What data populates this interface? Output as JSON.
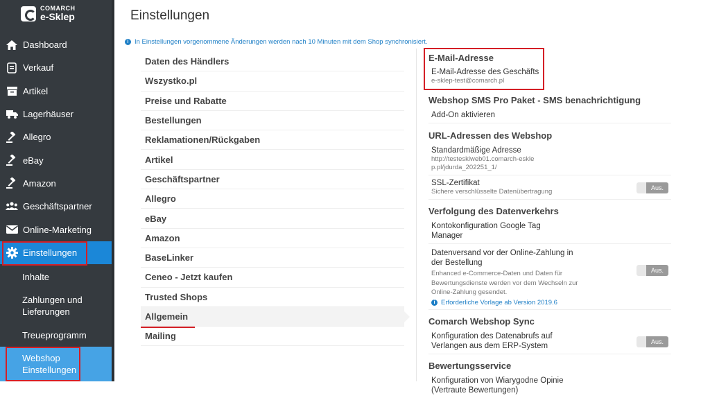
{
  "logo": {
    "line1": "COMARCH",
    "line2": "e-Sklep"
  },
  "sidebar": {
    "items": [
      {
        "label": "Dashboard"
      },
      {
        "label": "Verkauf"
      },
      {
        "label": "Artikel"
      },
      {
        "label": "Lagerhäuser"
      },
      {
        "label": "Allegro"
      },
      {
        "label": "eBay"
      },
      {
        "label": "Amazon"
      },
      {
        "label": "Geschäftspartner"
      },
      {
        "label": "Online-Marketing"
      },
      {
        "label": "Einstellungen"
      }
    ],
    "subitems": [
      {
        "label": "Inhalte"
      },
      {
        "label": "Zahlungen und Lieferungen"
      },
      {
        "label": "Treueprogramm"
      },
      {
        "label": "Webshop Einstellungen"
      }
    ]
  },
  "page": {
    "title": "Einstellungen",
    "info": "In Einstellungen vorgenommene Änderungen werden nach 10 Minuten mit dem Shop synchronisiert."
  },
  "menu": {
    "items": [
      {
        "label": "Daten des Händlers"
      },
      {
        "label": "Wszystko.pl"
      },
      {
        "label": "Preise und Rabatte"
      },
      {
        "label": "Bestellungen"
      },
      {
        "label": "Reklamationen/Rückgaben"
      },
      {
        "label": "Artikel"
      },
      {
        "label": "Geschäftspartner"
      },
      {
        "label": "Allegro"
      },
      {
        "label": "eBay"
      },
      {
        "label": "Amazon"
      },
      {
        "label": "BaseLinker"
      },
      {
        "label": "Ceneo - Jetzt kaufen"
      },
      {
        "label": "Trusted Shops"
      },
      {
        "label": "Allgemein"
      },
      {
        "label": "Mailing"
      }
    ]
  },
  "settings": {
    "email": {
      "title": "E-Mail-Adresse",
      "label": "E-Mail-Adresse des Geschäfts",
      "value": "e-sklep-test@comarch.pl"
    },
    "sms": {
      "title": "Webshop SMS Pro Paket - SMS benachrichtigung",
      "label": "Add-On aktivieren"
    },
    "urls": {
      "title": "URL-Adressen des Webshop",
      "std_label": "Standardmäßige Adresse",
      "std_value": "http://testesklweb01.comarch-esklep.pl/jdurda_202251_1/",
      "ssl_label": "SSL-Zertifikat",
      "ssl_desc": "Sichere verschlüsselte Datenübertragung",
      "ssl_toggle": "Aus."
    },
    "tracking": {
      "title": "Verfolgung des Datenverkehrs",
      "gtm_label": "Kontokonfiguration Google Tag Manager",
      "data_label": "Datenversand vor der Online-Zahlung in der Bestellung",
      "data_desc": "Enhanced e-Commerce-Daten und Daten für Bewertungsdienste werden vor dem Wechseln zur Online-Zahlung gesendet.",
      "data_note": "Erforderliche Vorlage ab Version 2019.6",
      "data_toggle": "Aus."
    },
    "sync": {
      "title": "Comarch Webshop Sync",
      "label": "Konfiguration des Datenabrufs auf Verlangen aus dem ERP-System",
      "toggle": "Aus."
    },
    "reviews": {
      "title": "Bewertungsservice",
      "label": "Konfiguration von Wiarygodne Opinie (Vertraute Bewertungen)"
    }
  }
}
